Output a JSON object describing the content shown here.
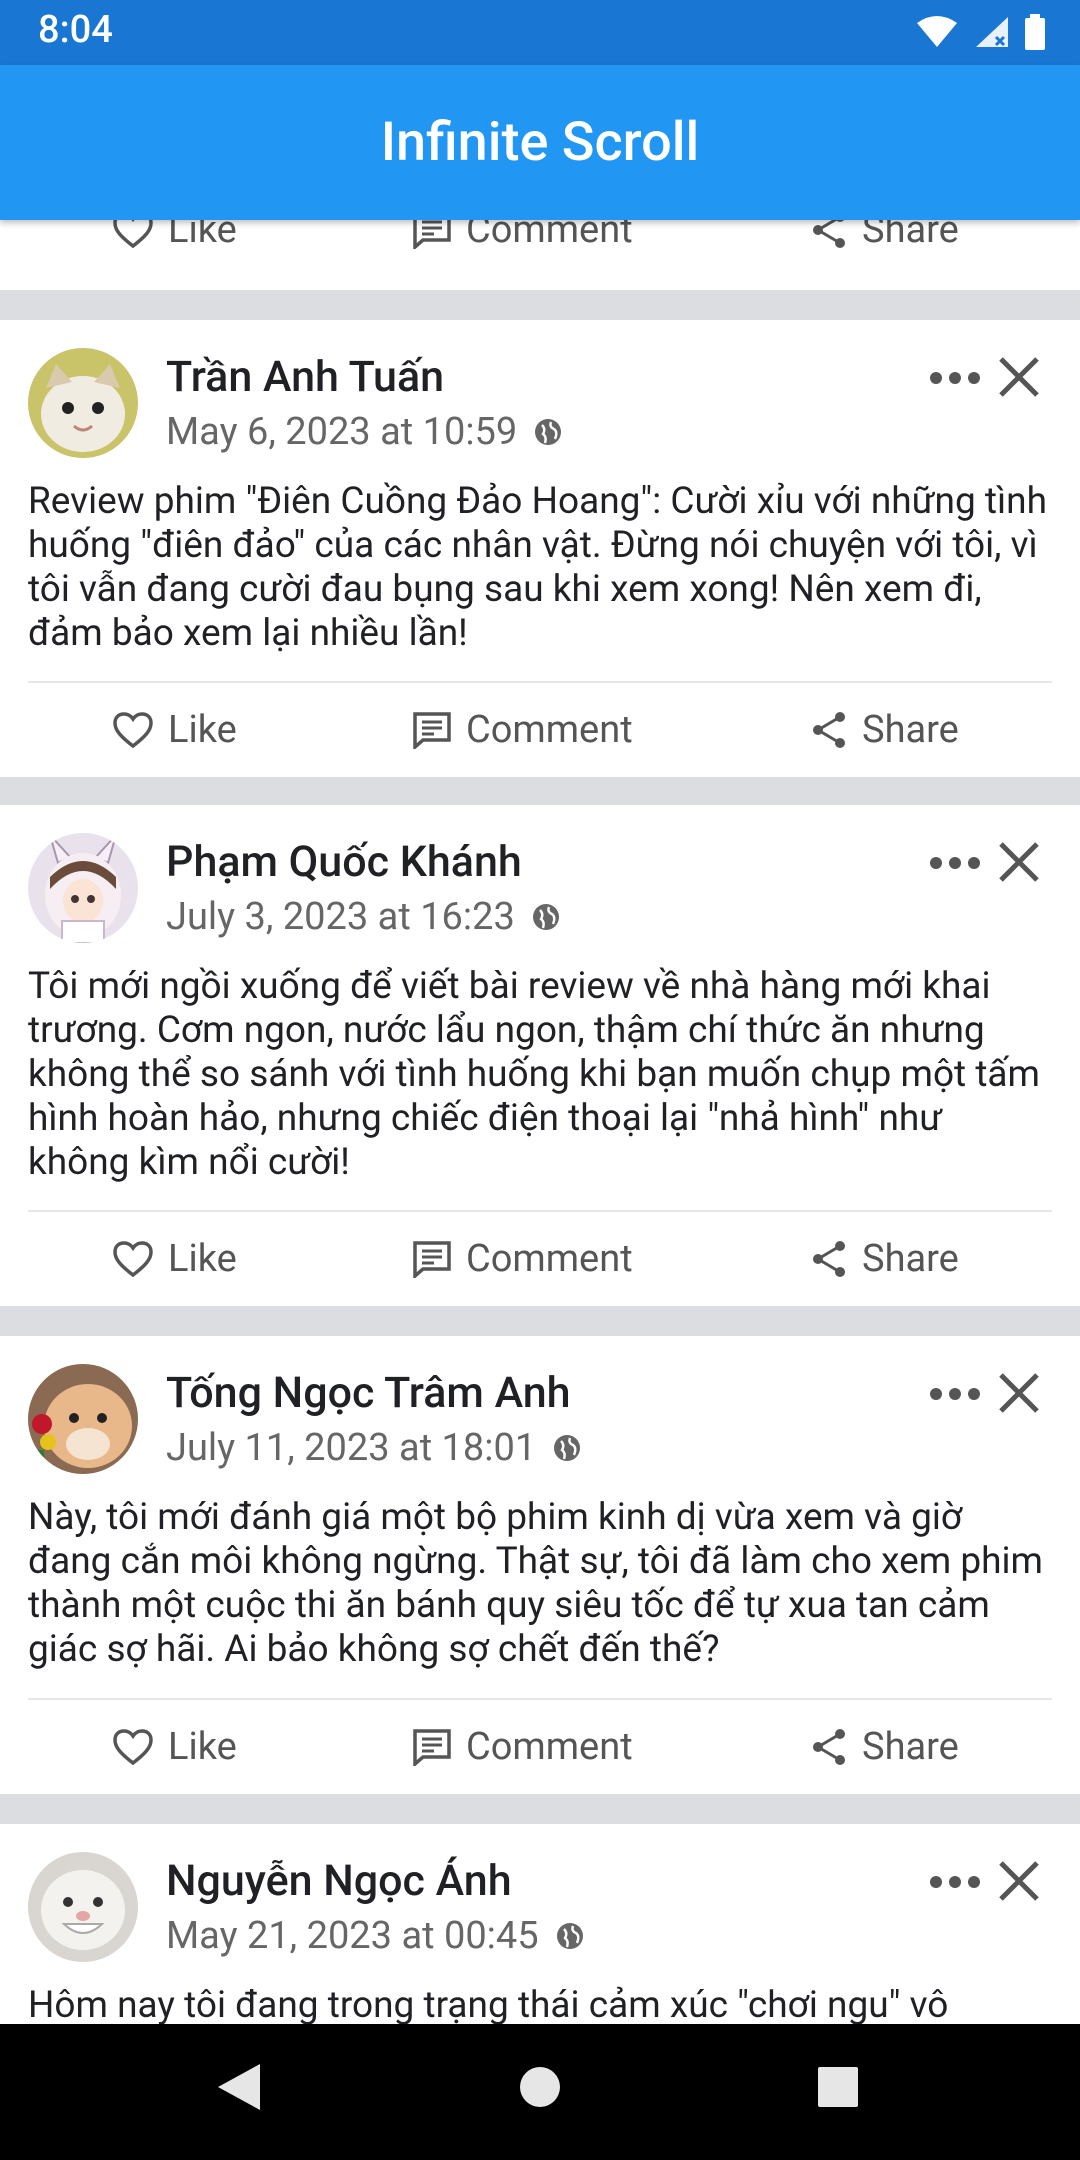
{
  "status_bar": {
    "time": "8:04"
  },
  "app_bar": {
    "title": "Infinite Scroll"
  },
  "actions": {
    "like": "Like",
    "comment": "Comment",
    "share": "Share"
  },
  "posts": [
    {
      "author": "Trần Anh Tuấn",
      "timestamp": "May 6, 2023 at 10:59",
      "content": "Review phim \"Điên Cuồng Đảo Hoang\": Cười xỉu với những tình huống \"điên đảo\" của các nhân vật. Đừng nói chuyện với tôi, vì tôi vẫn đang cười đau bụng sau khi xem xong! Nên xem đi, đảm bảo xem lại nhiều lần!"
    },
    {
      "author": "Phạm Quốc Khánh",
      "timestamp": "July 3, 2023 at 16:23",
      "content": "Tôi mới ngồi xuống để viết bài review về nhà hàng mới khai trương. Cơm ngon, nước lẩu ngon, thậm chí thức ăn nhưng không thể so sánh với tình huống khi bạn muốn chụp một tấm hình hoàn hảo, nhưng chiếc điện thoại lại \"nhả hình\" như không kìm nổi cười!"
    },
    {
      "author": "Tống Ngọc Trâm Anh",
      "timestamp": "July 11, 2023 at 18:01",
      "content": "Này, tôi mới đánh giá một bộ phim kinh dị vừa xem và giờ đang cắn môi không ngừng. Thật sự, tôi đã làm cho xem phim thành một cuộc thi ăn bánh quy siêu tốc để tự xua tan cảm giác sợ hãi. Ai bảo không sợ chết đến thế?"
    },
    {
      "author": "Nguyễn Ngọc Ánh",
      "timestamp": "May 21, 2023 at 00:45",
      "content": "Hôm nay tôi đang trong trạng thái cảm xúc \"chơi ngu\" vô"
    }
  ]
}
